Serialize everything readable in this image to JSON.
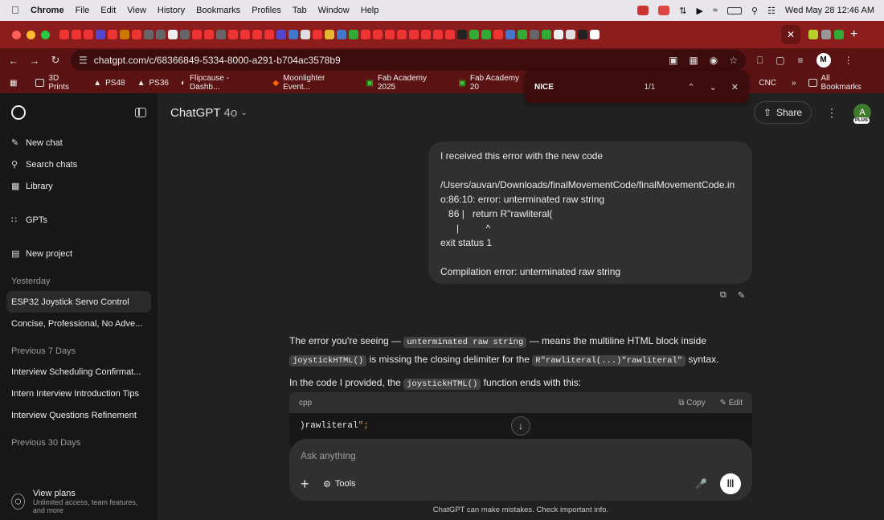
{
  "menubar": {
    "app": "Chrome",
    "items": [
      "File",
      "Edit",
      "View",
      "History",
      "Bookmarks",
      "Profiles",
      "Tab",
      "Window",
      "Help"
    ],
    "clock": "Wed May 28  12:46 AM"
  },
  "browser": {
    "url": "chatgpt.com/c/68366849-5334-8000-a291-b704ac3578b9",
    "bookmarks": [
      "3D Prints",
      "PS48",
      "PS36",
      "Flipcause - Dashb...",
      "Moonlighter Event...",
      "Fab Academy 2025",
      "Fab Academy 20",
      "CNC",
      "All Bookmarks"
    ],
    "find": {
      "query": "NICE",
      "count": "1/1"
    }
  },
  "sidebar": {
    "top_items": [
      {
        "label": "New chat",
        "icon": "edit-icon"
      },
      {
        "label": "Search chats",
        "icon": "search-icon"
      },
      {
        "label": "Library",
        "icon": "library-icon"
      }
    ],
    "gpts": "GPTs",
    "new_project": "New project",
    "sections": [
      {
        "title": "Yesterday",
        "chats": [
          "ESP32 Joystick Servo Control",
          "Concise, Professional, No Adve..."
        ]
      },
      {
        "title": "Previous 7 Days",
        "chats": [
          "Interview Scheduling Confirmat...",
          "Intern Interview Introduction Tips",
          "Interview Questions Refinement"
        ]
      },
      {
        "title": "Previous 30 Days",
        "chats": []
      }
    ],
    "view_plans": {
      "title": "View plans",
      "subtitle": "Unlimited access, team features, and more"
    }
  },
  "header": {
    "model": "ChatGPT",
    "version": "4o",
    "share": "Share",
    "avatar_letter": "A",
    "plan_badge": "PLUS"
  },
  "conversation": {
    "user_message": "I received this error with the new code\n\n/Users/auvan/Downloads/finalMovementCode/finalMovementCode.ino:86:10: error: unterminated raw string\n   86 |   return R\"rawliteral(\n      |          ^\nexit status 1\n\nCompilation error: unterminated raw string",
    "assistant": {
      "p1_a": "The error you're seeing — ",
      "p1_code1": "unterminated raw string",
      "p1_b": " — means the multiline HTML block inside ",
      "p1_code2": "joystickHTML()",
      "p1_c": " is missing the closing delimiter for the ",
      "p1_code3": "R\"rawliteral(...)\"rawliteral\"",
      "p1_d": " syntax.",
      "p2_a": "In the code I provided, the ",
      "p2_code": "joystickHTML()",
      "p2_b": " function ends with this:"
    },
    "code_block": {
      "lang": "cpp",
      "copy": "Copy",
      "edit": "Edit",
      "line_text": ")rawliteral",
      "line_str": "\";"
    }
  },
  "composer": {
    "placeholder": "Ask anything",
    "tools": "Tools"
  },
  "disclaimer": "ChatGPT can make mistakes. Check important info."
}
